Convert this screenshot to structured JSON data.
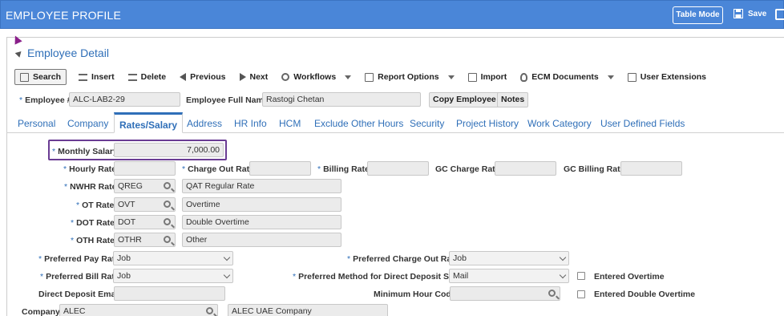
{
  "header": {
    "title": "EMPLOYEE PROFILE",
    "table_mode_label": "Table Mode",
    "save_label": "Save"
  },
  "section": {
    "title": "Employee Detail"
  },
  "toolbar": {
    "search": "Search",
    "insert": "Insert",
    "delete": "Delete",
    "previous": "Previous",
    "next": "Next",
    "workflows": "Workflows",
    "report_options": "Report Options",
    "import": "Import",
    "ecm_documents": "ECM Documents",
    "user_extensions": "User Extensions"
  },
  "employee": {
    "number_label": "Employee #",
    "number_value": "ALC-LAB2-29",
    "fullname_label": "Employee Full Name",
    "fullname_value": "Rastogi Chetan",
    "copy_button": "Copy Employee",
    "notes_button": "Notes"
  },
  "tabs": [
    "Personal",
    "Company",
    "Rates/Salary",
    "Address",
    "HR Info",
    "HCM",
    "Exclude Other Hours",
    "Security",
    "Project History",
    "Work Category",
    "User Defined Fields"
  ],
  "active_tab": "Rates/Salary",
  "form": {
    "monthly_salary_label": "Monthly Salary",
    "monthly_salary_value": "7,000.00",
    "hourly_rate_label": "Hourly Rate",
    "hourly_rate_value": "",
    "charge_out_rate_label": "Charge Out Rate",
    "charge_out_rate_value": "",
    "billing_rate_label": "Billing Rate",
    "billing_rate_value": "",
    "gc_charge_rate_label": "GC Charge Rate",
    "gc_charge_rate_value": "",
    "gc_billing_rate_label": "GC Billing Rate",
    "gc_billing_rate_value": "",
    "nwhr_rate_label": "NWHR Rate",
    "nwhr_rate_code": "QREG",
    "nwhr_rate_desc": "QAT Regular Rate",
    "ot_rate_label": "OT Rate",
    "ot_rate_code": "OVT",
    "ot_rate_desc": "Overtime",
    "dot_rate_label": "DOT Rate",
    "dot_rate_code": "DOT",
    "dot_rate_desc": "Double Overtime",
    "oth_rate_label": "OTH Rate",
    "oth_rate_code": "OTHR",
    "oth_rate_desc": "Other",
    "preferred_pay_rate_label": "Preferred Pay Rate",
    "preferred_pay_rate_value": "Job",
    "preferred_charge_out_rate_label": "Preferred Charge Out Rate",
    "preferred_charge_out_rate_value": "Job",
    "preferred_bill_rate_label": "Preferred Bill Rate",
    "preferred_bill_rate_value": "Job",
    "preferred_method_dd_label": "Preferred Method for Direct Deposit Stubs",
    "preferred_method_dd_value": "Mail",
    "entered_overtime_label": "Entered Overtime",
    "direct_deposit_email_label": "Direct Deposit Email",
    "direct_deposit_email_value": "",
    "minimum_hour_code_label": "Minimum Hour Code",
    "minimum_hour_code_value": "",
    "entered_double_overtime_label": "Entered Double Overtime",
    "company_label": "Company",
    "company_code": "ALEC",
    "company_name": "ALEC UAE Company"
  },
  "required_marker": "*",
  "colors": {
    "header_bg": "#4a86d8",
    "accent": "#2f6fb8",
    "highlight": "#6a3c93"
  }
}
